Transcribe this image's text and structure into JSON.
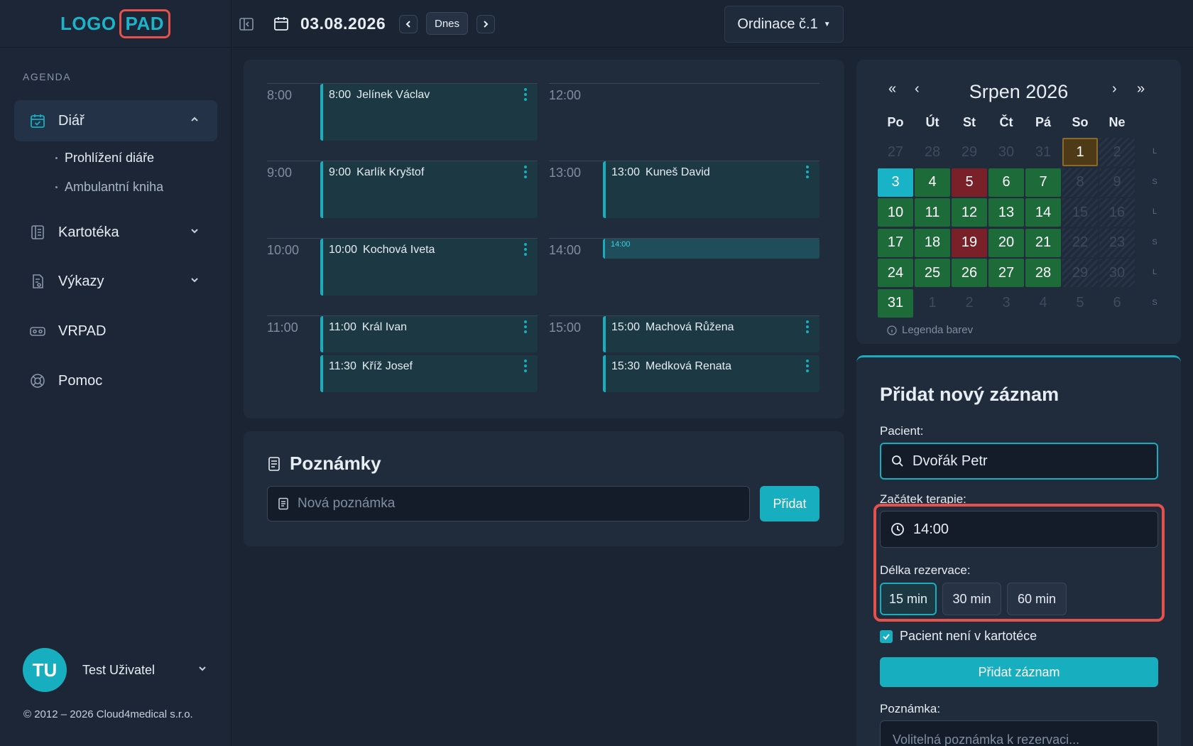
{
  "logo": {
    "left": "LOGO",
    "right": "PAD"
  },
  "sidebar": {
    "section_label": "AGENDA",
    "items": [
      {
        "label": "Diář",
        "icon": "calendar-check-icon",
        "expanded": true
      },
      {
        "label": "Kartotéka",
        "icon": "file-cabinet-icon",
        "expanded": false
      },
      {
        "label": "Výkazy",
        "icon": "report-icon",
        "expanded": false
      },
      {
        "label": "VRPAD",
        "icon": "vr-headset-icon"
      },
      {
        "label": "Pomoc",
        "icon": "lifebuoy-icon"
      }
    ],
    "subitems": [
      {
        "label": "Prohlížení diáře"
      },
      {
        "label": "Ambulantní kniha"
      }
    ],
    "user": {
      "initials": "TU",
      "name": "Test Uživatel"
    },
    "copyright": "© 2012 – 2026 Cloud4medical s.r.o."
  },
  "topbar": {
    "date": "03.08.2026",
    "today_label": "Dnes",
    "clinic": "Ordinace č.1"
  },
  "schedule": {
    "hours_left": [
      "8:00",
      "9:00",
      "10:00",
      "11:00"
    ],
    "hours_right": [
      "12:00",
      "13:00",
      "14:00",
      "15:00"
    ],
    "appointments_left": [
      {
        "time": "8:00",
        "name": "Jelínek Václav"
      },
      {
        "time": "9:00",
        "name": "Karlík Kryštof"
      },
      {
        "time": "10:00",
        "name": "Kochová Iveta"
      },
      {
        "time": "11:00",
        "name": "Král Ivan"
      },
      {
        "time": "11:30",
        "name": "Kříž Josef"
      }
    ],
    "appointments_right": [
      {
        "time": "13:00",
        "name": "Kuneš David"
      },
      {
        "time": "14:00",
        "name": ""
      },
      {
        "time": "15:00",
        "name": "Machová Růžena"
      },
      {
        "time": "15:30",
        "name": "Medková Renata"
      }
    ]
  },
  "notes": {
    "title": "Poznámky",
    "placeholder": "Nová poznámka",
    "add_label": "Přidat"
  },
  "calendar": {
    "month_title": "Srpen 2026",
    "weekdays": [
      "Po",
      "Út",
      "St",
      "Čt",
      "Pá",
      "So",
      "Ne"
    ],
    "weeks": [
      {
        "days": [
          "27",
          "28",
          "29",
          "30",
          "31",
          "1",
          "2"
        ],
        "tag": "L"
      },
      {
        "days": [
          "3",
          "4",
          "5",
          "6",
          "7",
          "8",
          "9"
        ],
        "tag": "S"
      },
      {
        "days": [
          "10",
          "11",
          "12",
          "13",
          "14",
          "15",
          "16"
        ],
        "tag": "L"
      },
      {
        "days": [
          "17",
          "18",
          "19",
          "20",
          "21",
          "22",
          "23"
        ],
        "tag": "S"
      },
      {
        "days": [
          "24",
          "25",
          "26",
          "27",
          "28",
          "29",
          "30"
        ],
        "tag": "L"
      },
      {
        "days": [
          "31",
          "1",
          "2",
          "3",
          "4",
          "5",
          "6"
        ],
        "tag": "S"
      }
    ],
    "legend": "Legenda barev"
  },
  "add_record": {
    "title": "Přidat nový záznam",
    "patient_label": "Pacient:",
    "patient_value": "Dvořák Petr",
    "start_label": "Začátek terapie:",
    "start_value": "14:00",
    "duration_label": "Délka rezervace:",
    "durations": [
      "15 min",
      "30 min",
      "60 min"
    ],
    "selected_duration": "15 min",
    "not_in_registry_label": "Pacient není v kartotéce",
    "not_in_registry_checked": true,
    "submit_label": "Přidat záznam",
    "note_label": "Poznámka:",
    "note_placeholder": "Volitelná poznámka k rezervaci..."
  },
  "colors": {
    "accent": "#17aebf",
    "highlight": "#e2514c",
    "available": "#1e6b3a",
    "full": "#7a2028",
    "selected": "#4f3a18"
  }
}
